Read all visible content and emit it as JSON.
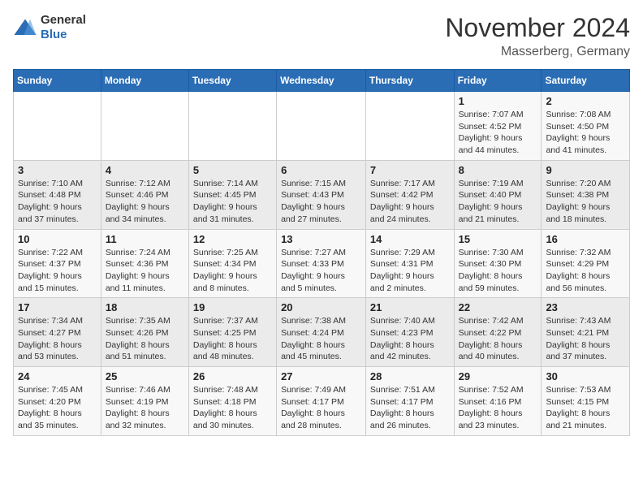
{
  "logo": {
    "general": "General",
    "blue": "Blue"
  },
  "header": {
    "month": "November 2024",
    "location": "Masserberg, Germany"
  },
  "days_of_week": [
    "Sunday",
    "Monday",
    "Tuesday",
    "Wednesday",
    "Thursday",
    "Friday",
    "Saturday"
  ],
  "weeks": [
    [
      {
        "day": "",
        "info": ""
      },
      {
        "day": "",
        "info": ""
      },
      {
        "day": "",
        "info": ""
      },
      {
        "day": "",
        "info": ""
      },
      {
        "day": "",
        "info": ""
      },
      {
        "day": "1",
        "info": "Sunrise: 7:07 AM\nSunset: 4:52 PM\nDaylight: 9 hours and 44 minutes."
      },
      {
        "day": "2",
        "info": "Sunrise: 7:08 AM\nSunset: 4:50 PM\nDaylight: 9 hours and 41 minutes."
      }
    ],
    [
      {
        "day": "3",
        "info": "Sunrise: 7:10 AM\nSunset: 4:48 PM\nDaylight: 9 hours and 37 minutes."
      },
      {
        "day": "4",
        "info": "Sunrise: 7:12 AM\nSunset: 4:46 PM\nDaylight: 9 hours and 34 minutes."
      },
      {
        "day": "5",
        "info": "Sunrise: 7:14 AM\nSunset: 4:45 PM\nDaylight: 9 hours and 31 minutes."
      },
      {
        "day": "6",
        "info": "Sunrise: 7:15 AM\nSunset: 4:43 PM\nDaylight: 9 hours and 27 minutes."
      },
      {
        "day": "7",
        "info": "Sunrise: 7:17 AM\nSunset: 4:42 PM\nDaylight: 9 hours and 24 minutes."
      },
      {
        "day": "8",
        "info": "Sunrise: 7:19 AM\nSunset: 4:40 PM\nDaylight: 9 hours and 21 minutes."
      },
      {
        "day": "9",
        "info": "Sunrise: 7:20 AM\nSunset: 4:38 PM\nDaylight: 9 hours and 18 minutes."
      }
    ],
    [
      {
        "day": "10",
        "info": "Sunrise: 7:22 AM\nSunset: 4:37 PM\nDaylight: 9 hours and 15 minutes."
      },
      {
        "day": "11",
        "info": "Sunrise: 7:24 AM\nSunset: 4:36 PM\nDaylight: 9 hours and 11 minutes."
      },
      {
        "day": "12",
        "info": "Sunrise: 7:25 AM\nSunset: 4:34 PM\nDaylight: 9 hours and 8 minutes."
      },
      {
        "day": "13",
        "info": "Sunrise: 7:27 AM\nSunset: 4:33 PM\nDaylight: 9 hours and 5 minutes."
      },
      {
        "day": "14",
        "info": "Sunrise: 7:29 AM\nSunset: 4:31 PM\nDaylight: 9 hours and 2 minutes."
      },
      {
        "day": "15",
        "info": "Sunrise: 7:30 AM\nSunset: 4:30 PM\nDaylight: 8 hours and 59 minutes."
      },
      {
        "day": "16",
        "info": "Sunrise: 7:32 AM\nSunset: 4:29 PM\nDaylight: 8 hours and 56 minutes."
      }
    ],
    [
      {
        "day": "17",
        "info": "Sunrise: 7:34 AM\nSunset: 4:27 PM\nDaylight: 8 hours and 53 minutes."
      },
      {
        "day": "18",
        "info": "Sunrise: 7:35 AM\nSunset: 4:26 PM\nDaylight: 8 hours and 51 minutes."
      },
      {
        "day": "19",
        "info": "Sunrise: 7:37 AM\nSunset: 4:25 PM\nDaylight: 8 hours and 48 minutes."
      },
      {
        "day": "20",
        "info": "Sunrise: 7:38 AM\nSunset: 4:24 PM\nDaylight: 8 hours and 45 minutes."
      },
      {
        "day": "21",
        "info": "Sunrise: 7:40 AM\nSunset: 4:23 PM\nDaylight: 8 hours and 42 minutes."
      },
      {
        "day": "22",
        "info": "Sunrise: 7:42 AM\nSunset: 4:22 PM\nDaylight: 8 hours and 40 minutes."
      },
      {
        "day": "23",
        "info": "Sunrise: 7:43 AM\nSunset: 4:21 PM\nDaylight: 8 hours and 37 minutes."
      }
    ],
    [
      {
        "day": "24",
        "info": "Sunrise: 7:45 AM\nSunset: 4:20 PM\nDaylight: 8 hours and 35 minutes."
      },
      {
        "day": "25",
        "info": "Sunrise: 7:46 AM\nSunset: 4:19 PM\nDaylight: 8 hours and 32 minutes."
      },
      {
        "day": "26",
        "info": "Sunrise: 7:48 AM\nSunset: 4:18 PM\nDaylight: 8 hours and 30 minutes."
      },
      {
        "day": "27",
        "info": "Sunrise: 7:49 AM\nSunset: 4:17 PM\nDaylight: 8 hours and 28 minutes."
      },
      {
        "day": "28",
        "info": "Sunrise: 7:51 AM\nSunset: 4:17 PM\nDaylight: 8 hours and 26 minutes."
      },
      {
        "day": "29",
        "info": "Sunrise: 7:52 AM\nSunset: 4:16 PM\nDaylight: 8 hours and 23 minutes."
      },
      {
        "day": "30",
        "info": "Sunrise: 7:53 AM\nSunset: 4:15 PM\nDaylight: 8 hours and 21 minutes."
      }
    ]
  ]
}
